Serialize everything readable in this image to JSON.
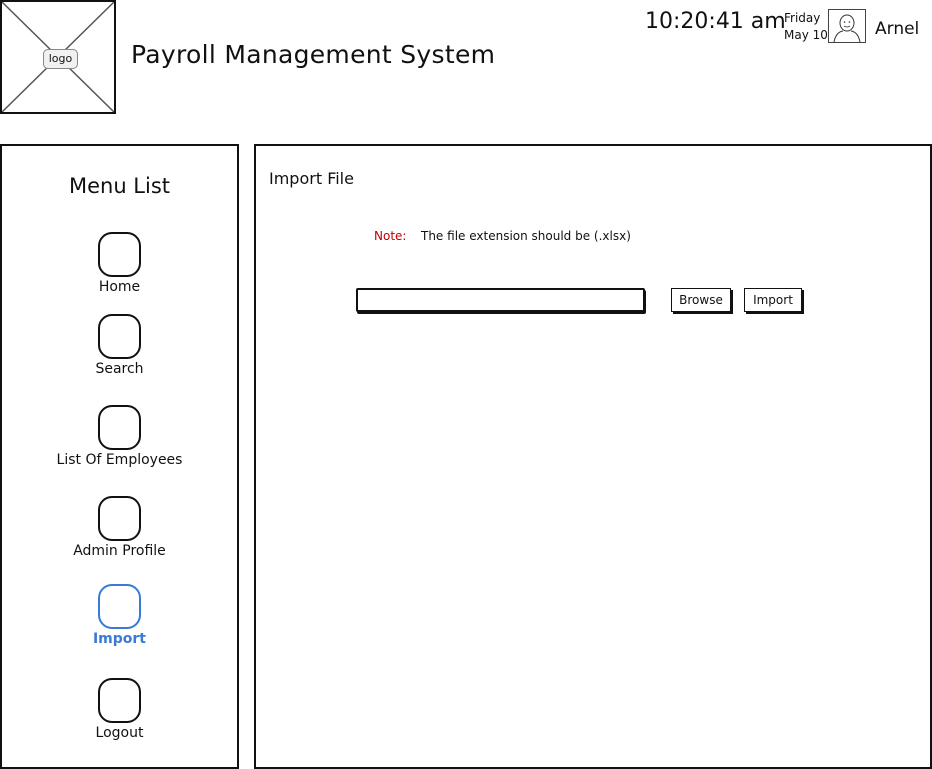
{
  "header": {
    "logo_label": "logo",
    "app_title": "Payroll Management System",
    "time": "10:20:41 am",
    "weekday": "Friday",
    "date": "May 10",
    "user_name": "Arnel"
  },
  "sidebar": {
    "title": "Menu List",
    "items": [
      {
        "label": "Home"
      },
      {
        "label": "Search"
      },
      {
        "label": "List Of Employees"
      },
      {
        "label": "Admin Profile"
      },
      {
        "label": "Import",
        "active": true
      },
      {
        "label": "Logout"
      }
    ]
  },
  "main": {
    "section_title": "Import File",
    "note_label": "Note:",
    "note_text": "The file extension should be (.xlsx)",
    "file_input_value": "",
    "browse_label": "Browse",
    "import_label": "Import"
  },
  "colors": {
    "accent": "#3a7ad6",
    "note": "#c00000"
  }
}
